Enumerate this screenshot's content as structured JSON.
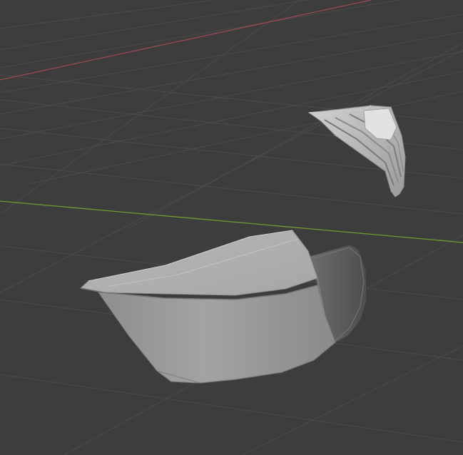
{
  "viewport": {
    "background_color": "#3d3d3d",
    "grid_line_color": "#4b4b4b",
    "x_axis_color": "#9a4a50",
    "y_axis_color": "#6f9a30",
    "mesh_light_color": "#b5b5b5",
    "mesh_mid_color": "#9a9a9a",
    "mesh_dark_color": "#6a6a6a"
  },
  "objects": [
    {
      "name": "bowl-shaped-mesh"
    },
    {
      "name": "ribbed-fragment-mesh"
    }
  ]
}
